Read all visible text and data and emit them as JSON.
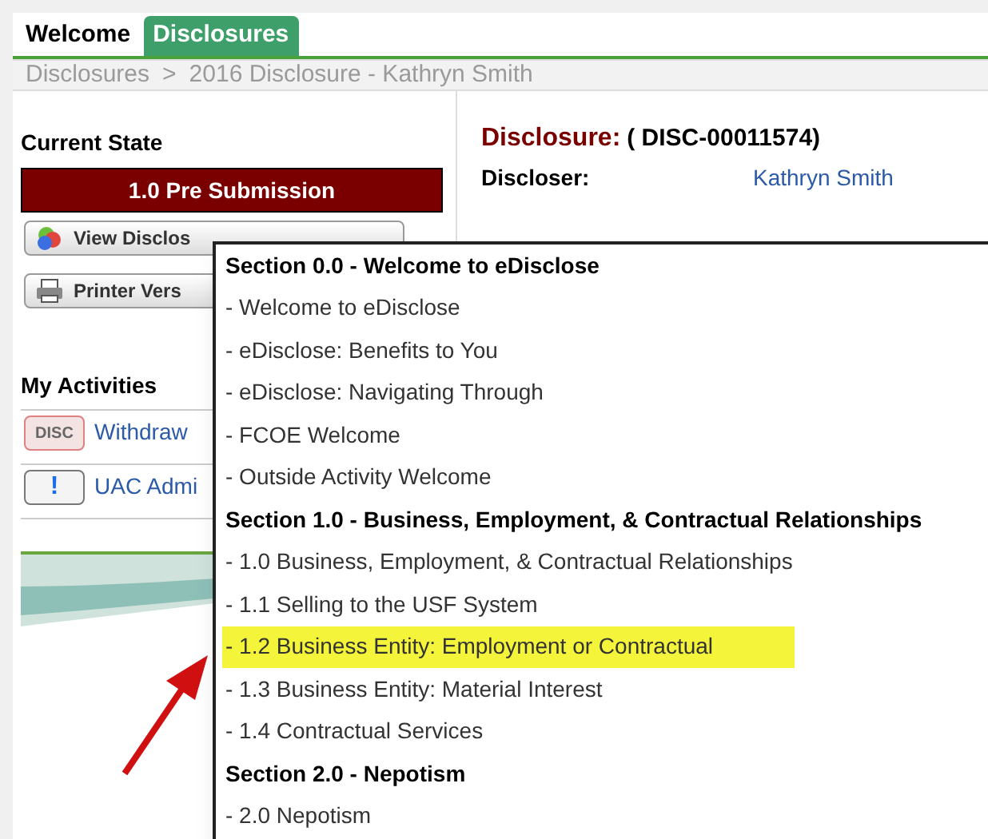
{
  "tabs": [
    {
      "label": "Welcome",
      "selected": false
    },
    {
      "label": "Disclosures",
      "selected": true
    }
  ],
  "breadcrumb": [
    "Disclosures",
    ">",
    "2016 Disclosure - Kathryn Smith"
  ],
  "sidebar": {
    "state_heading": "Current State",
    "state": "1.0 Pre Submission",
    "buttons": [
      {
        "label": "View Disclos",
        "kind": "view"
      },
      {
        "label": "Printer Vers",
        "kind": "print"
      }
    ],
    "activities_heading": "My Activities",
    "activities": [
      {
        "badge": "DISC",
        "kind": "disc",
        "label": "Withdraw"
      },
      {
        "badge": "!",
        "kind": "alert",
        "label": "UAC Admi"
      }
    ]
  },
  "disclosure": {
    "title": "Disclosure:",
    "id": "( DISC-00011574)",
    "discloser_label": "Discloser:",
    "discloser": "Kathryn Smith"
  },
  "menu": [
    {
      "kind": "section",
      "label": "Section 0.0 - Welcome to eDisclose",
      "selected": false
    },
    {
      "kind": "item",
      "label": "- Welcome to eDisclose",
      "selected": false
    },
    {
      "kind": "item",
      "label": "- eDisclose: Benefits to You",
      "selected": false
    },
    {
      "kind": "item",
      "label": "- eDisclose: Navigating Through",
      "selected": false
    },
    {
      "kind": "item",
      "label": "- FCOE Welcome",
      "selected": false
    },
    {
      "kind": "item",
      "label": "- Outside Activity Welcome",
      "selected": false
    },
    {
      "kind": "section",
      "label": "Section 1.0 - Business, Employment, & Contractual Relationships",
      "selected": false
    },
    {
      "kind": "item",
      "label": "- 1.0 Business, Employment, & Contractual Relationships",
      "selected": false
    },
    {
      "kind": "item",
      "label": "- 1.1 Selling to the USF System",
      "selected": false
    },
    {
      "kind": "item",
      "label": "- 1.2 Business Entity: Employment or Contractual",
      "selected": true
    },
    {
      "kind": "item",
      "label": "- 1.3 Business Entity: Material Interest",
      "selected": false
    },
    {
      "kind": "item",
      "label": "- 1.4 Contractual Services",
      "selected": false
    },
    {
      "kind": "section",
      "label": "Section 2.0 - Nepotism",
      "selected": false
    },
    {
      "kind": "item",
      "label": "- 2.0 Nepotism",
      "selected": false
    }
  ]
}
